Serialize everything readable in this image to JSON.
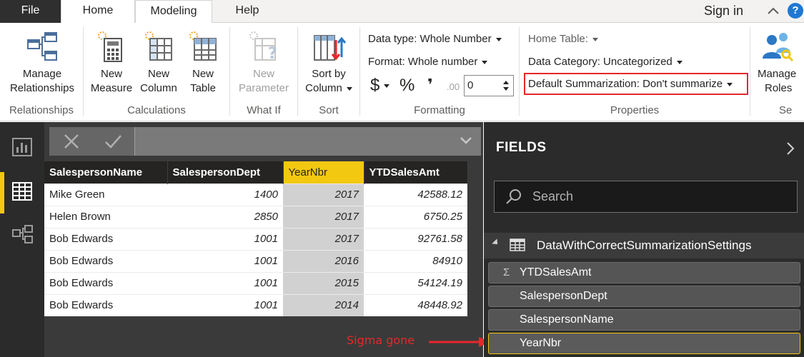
{
  "menu": {
    "file": "File",
    "home": "Home",
    "modeling": "Modeling",
    "help": "Help",
    "sign_in": "Sign in",
    "help_icon": "?"
  },
  "ribbon": {
    "relationships": {
      "manage_line1": "Manage",
      "manage_line2": "Relationships",
      "group": "Relationships"
    },
    "calculations": {
      "new_measure_1": "New",
      "new_measure_2": "Measure",
      "new_column_1": "New",
      "new_column_2": "Column",
      "new_table_1": "New",
      "new_table_2": "Table",
      "group": "Calculations"
    },
    "whatif": {
      "param_1": "New",
      "param_2": "Parameter",
      "group": "What If"
    },
    "sort": {
      "sort_1": "Sort by",
      "sort_2": "Column",
      "group": "Sort"
    },
    "formatting": {
      "data_type": "Data type: Whole Number",
      "format": "Format: Whole number",
      "currency": "$",
      "percent": "%",
      "comma": "❜",
      "decimals": ".00",
      "decimal_value": "0",
      "group": "Formatting"
    },
    "properties": {
      "home_table": "Home Table:",
      "data_category": "Data Category: Uncategorized",
      "default_summarization": "Default Summarization: Don't summarize",
      "group": "Properties"
    },
    "security": {
      "manage_1": "Manage",
      "manage_2": "Roles",
      "group": "Se"
    }
  },
  "grid": {
    "columns": [
      "SalespersonName",
      "SalespersonDept",
      "YearNbr",
      "YTDSalesAmt"
    ],
    "rows": [
      [
        "Mike Green",
        "1400",
        "2017",
        "42588.12"
      ],
      [
        "Helen Brown",
        "2850",
        "2017",
        "6750.25"
      ],
      [
        "Bob Edwards",
        "1001",
        "2017",
        "92761.58"
      ],
      [
        "Bob Edwards",
        "1001",
        "2016",
        "84910"
      ],
      [
        "Bob Edwards",
        "1001",
        "2015",
        "54124.19"
      ],
      [
        "Bob Edwards",
        "1001",
        "2014",
        "48448.92"
      ]
    ]
  },
  "annotation": "Sigma gone",
  "fields": {
    "title": "FIELDS",
    "search_placeholder": "Search",
    "table_name": "DataWithCorrectSummarizationSettings",
    "items": [
      {
        "label": "YTDSalesAmt",
        "sigma": "Σ"
      },
      {
        "label": "SalespersonDept",
        "sigma": ""
      },
      {
        "label": "SalespersonName",
        "sigma": ""
      },
      {
        "label": "YearNbr",
        "sigma": ""
      }
    ]
  },
  "colors": {
    "accent": "#f2c811",
    "annotation": "#e8262b",
    "file_tab": "#2f2f2f"
  }
}
